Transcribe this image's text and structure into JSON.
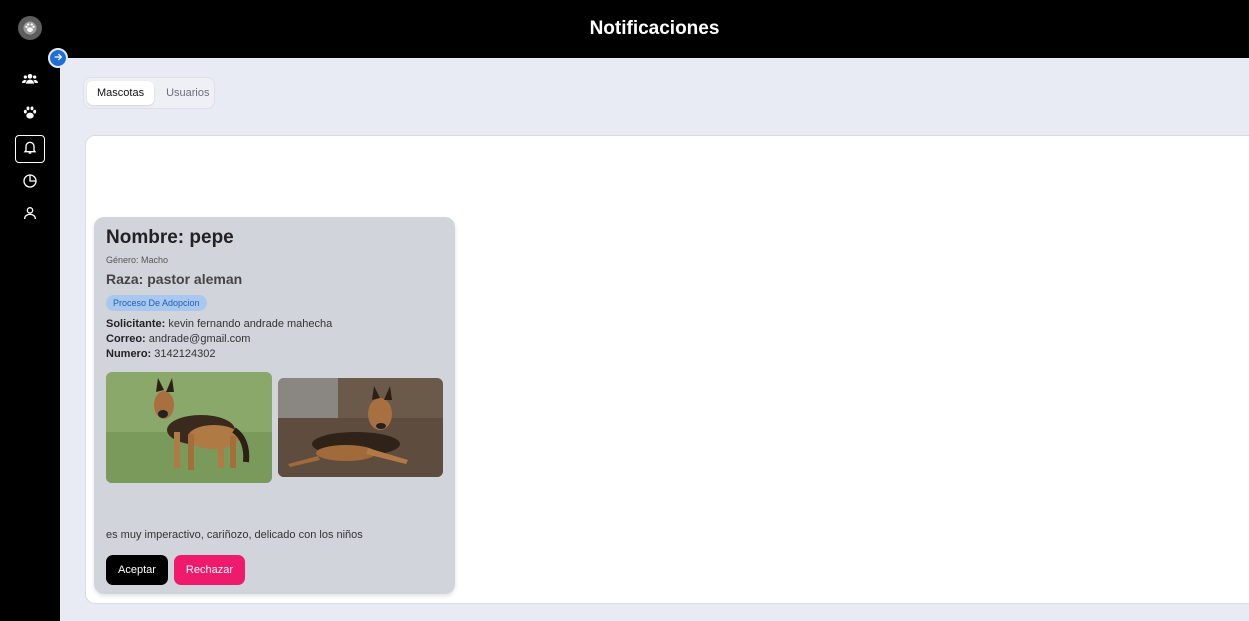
{
  "header": {
    "title": "Notificaciones"
  },
  "sidebar": {
    "items": [
      {
        "icon": "users-icon",
        "active": false
      },
      {
        "icon": "paw-icon",
        "active": false
      },
      {
        "icon": "bell-icon",
        "active": true
      },
      {
        "icon": "pie-chart-icon",
        "active": false
      },
      {
        "icon": "user-icon",
        "active": false
      }
    ]
  },
  "tabs": [
    {
      "label": "Mascotas",
      "active": true
    },
    {
      "label": "Usuarios",
      "active": false
    }
  ],
  "card": {
    "name": "Nombre: pepe",
    "gender": "Género: Macho",
    "breed": "Raza: pastor aleman",
    "status_badge": "Proceso De Adopcion",
    "applicant_label": "Solicitante:",
    "applicant_value": " kevin fernando andrade mahecha",
    "email_label": "Correo:",
    "email_value": " andrade@gmail.com",
    "phone_label": "Numero:",
    "phone_value": " 3142124302",
    "description": "es muy imperactivo, cariñozo, delicado con los niños",
    "accept_label": "Aceptar",
    "reject_label": "Rechazar"
  },
  "colors": {
    "accent": "#1f6fd6",
    "reject": "#ef1a6b",
    "badge_bg": "#a8c8f0",
    "badge_text": "#1f5fb0"
  }
}
